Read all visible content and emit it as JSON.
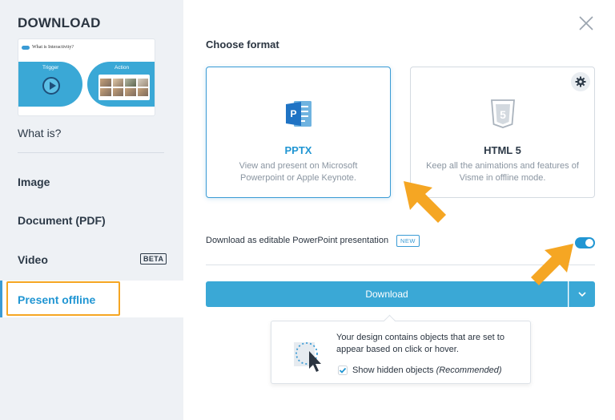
{
  "sidebar": {
    "title": "DOWNLOAD",
    "thumbnail": {
      "heading": "What is Interactivity?",
      "trigger_label": "Trigger",
      "action_label": "Action"
    },
    "what_is_label": "What is?",
    "items": [
      {
        "label": "Image"
      },
      {
        "label": "Document (PDF)"
      },
      {
        "label": "Video",
        "badge": "BETA"
      },
      {
        "label": "Present offline",
        "active": true
      }
    ]
  },
  "main": {
    "section_title": "Choose format",
    "formats": [
      {
        "name": "PPTX",
        "description": "View and present on Microsoft Powerpoint or Apple Keynote.",
        "selected": true,
        "icon": "pptx-icon"
      },
      {
        "name": "HTML 5",
        "description": "Keep all the animations and features of Visme in offline mode.",
        "selected": false,
        "icon": "html5-icon"
      }
    ],
    "editable_label": "Download as editable PowerPoint presentation",
    "new_badge": "NEW",
    "editable_toggle_on": true,
    "download_label": "Download",
    "popup": {
      "message": "Your design contains objects that are set to appear based on click or hover.",
      "checkbox_label": "Show hidden objects",
      "checkbox_note": "(Recommended)",
      "checkbox_checked": true
    }
  },
  "colors": {
    "accent": "#3aa8d6",
    "accent_dark": "#2196d3",
    "highlight": "#f5a623",
    "sidebar_bg": "#eef1f5"
  }
}
